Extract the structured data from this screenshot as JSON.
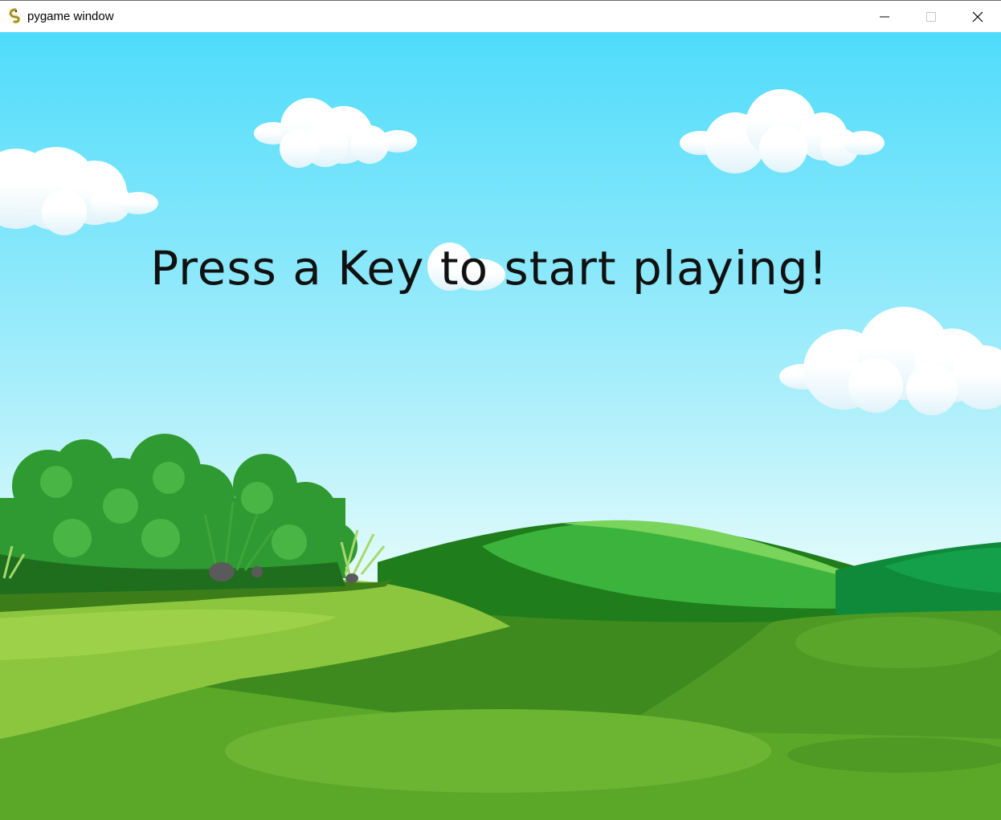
{
  "window": {
    "title": "pygame window",
    "icon": "pygame-snake-icon",
    "controls": {
      "minimize": "minimize-icon",
      "maximize": "maximize-icon",
      "close": "close-icon"
    }
  },
  "game": {
    "prompt": "Press a Key to start playing!",
    "colors": {
      "sky_top": "#4fdcfb",
      "sky_bottom": "#e4fbfb",
      "grass_light": "#8cc63f",
      "grass_mid": "#5ba829",
      "grass_dark": "#3f8a1f",
      "hill_bright": "#39ad3a",
      "bush": "#2f9a32",
      "prompt_text": "#111111"
    }
  }
}
